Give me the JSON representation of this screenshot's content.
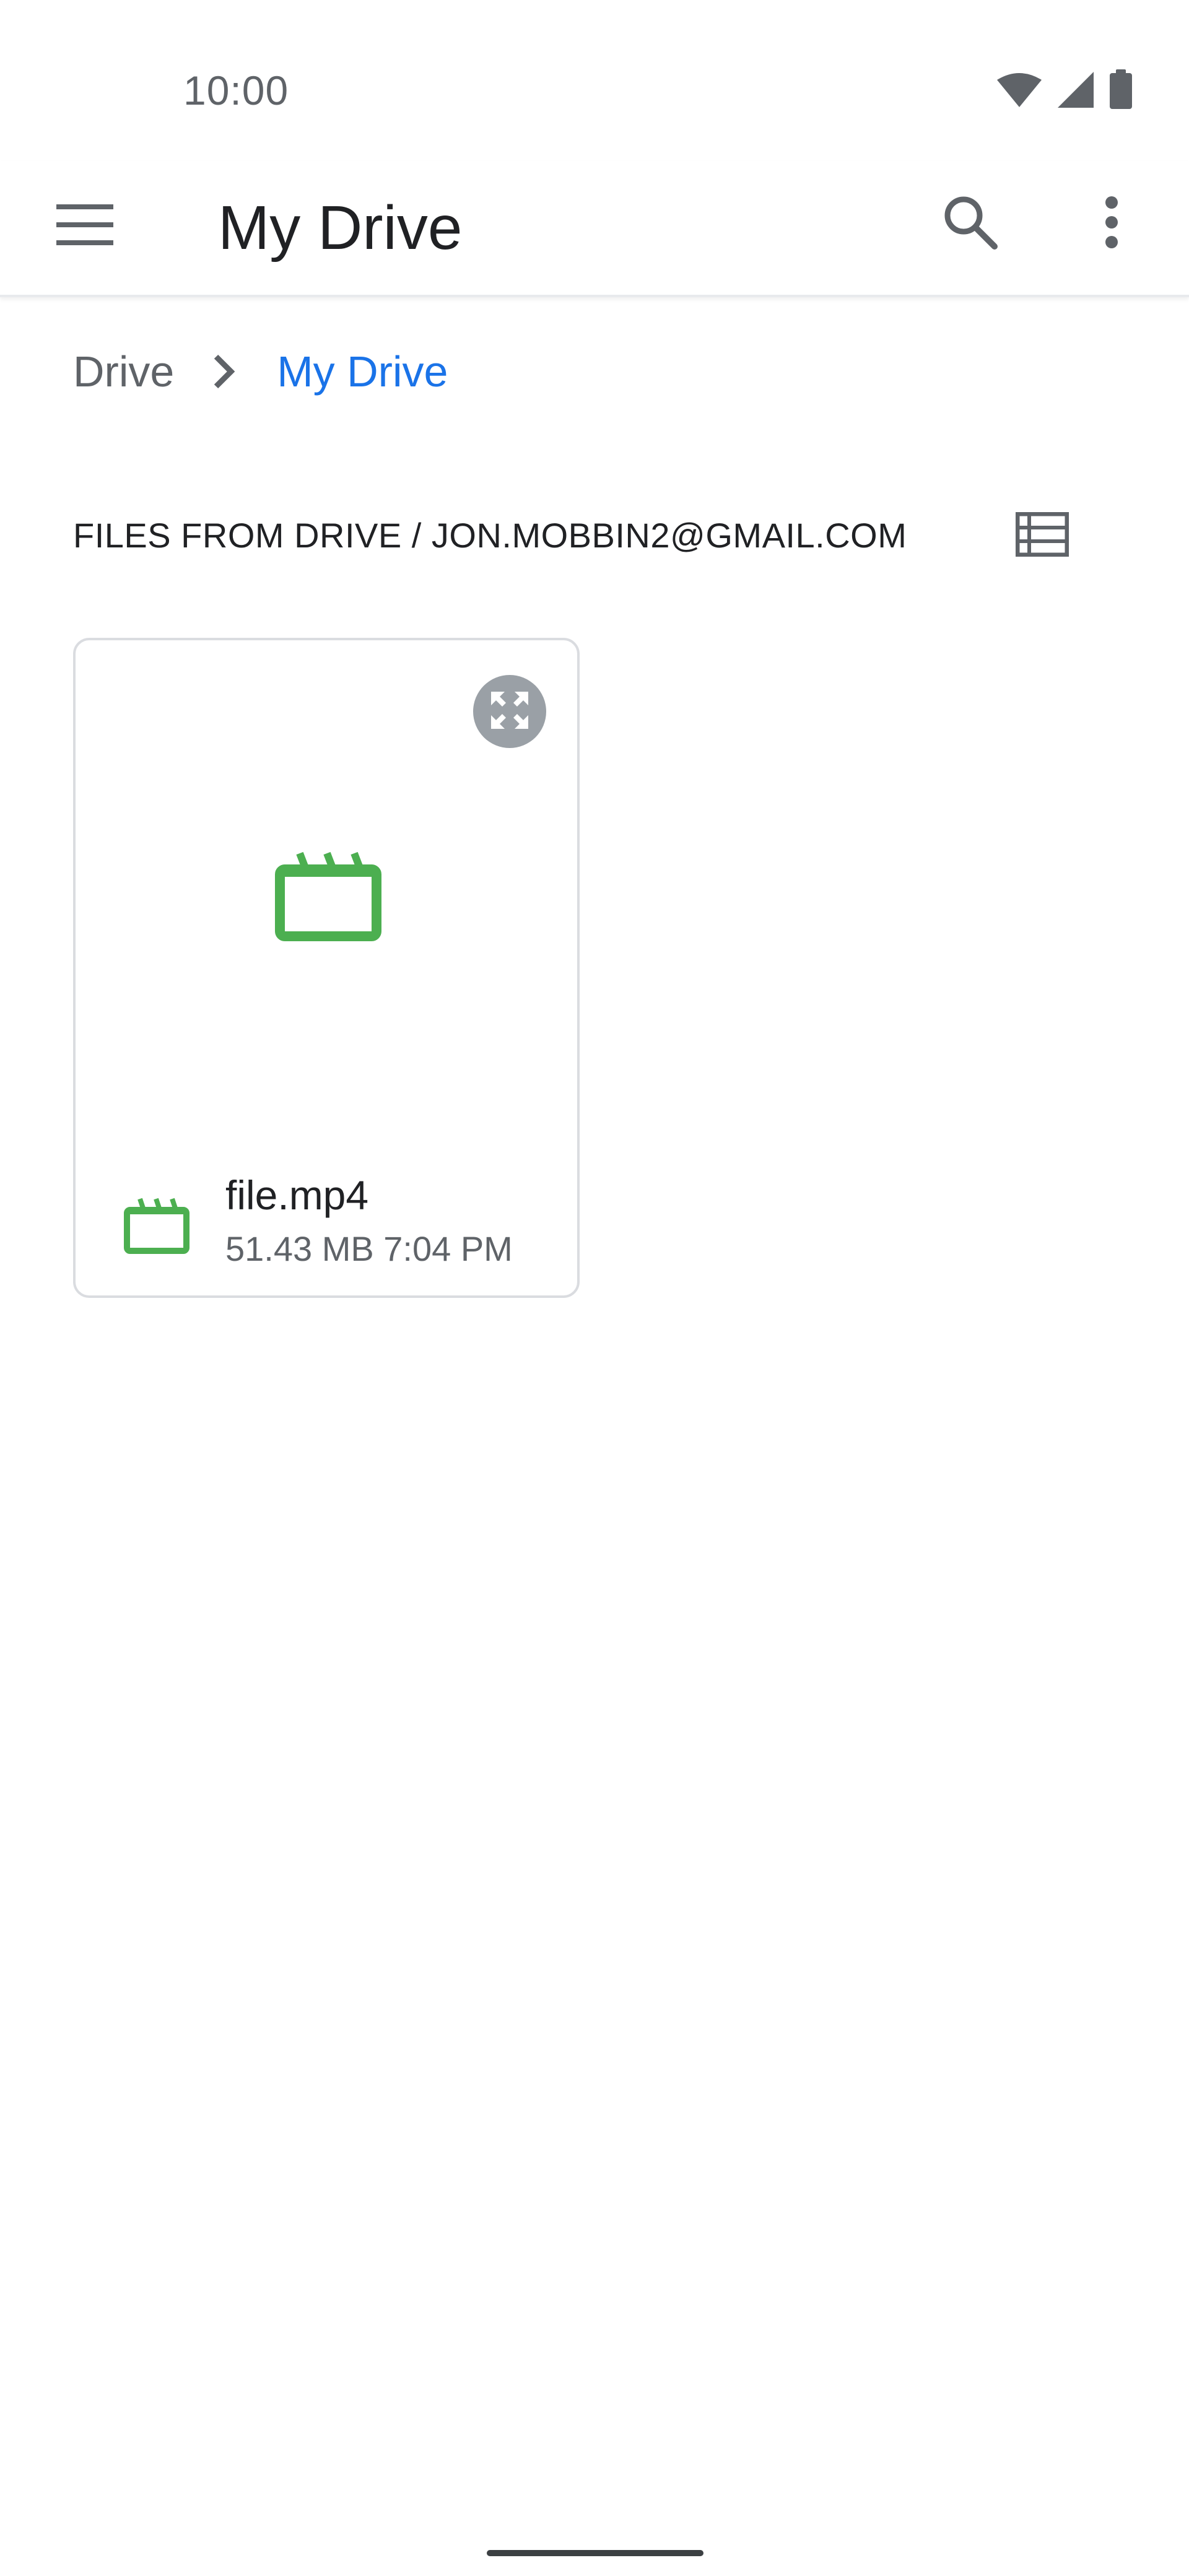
{
  "status_bar": {
    "time": "10:00",
    "icons": [
      "wifi-icon",
      "cellular-signal-icon",
      "battery-icon"
    ]
  },
  "app_bar": {
    "title": "My Drive",
    "icons": [
      "menu-icon",
      "search-icon",
      "more-vert-icon"
    ]
  },
  "breadcrumb": {
    "items": [
      "Drive",
      "My Drive"
    ],
    "separator_icon": "chevron-right-icon"
  },
  "section": {
    "header": "FILES FROM DRIVE / JON.MOBBIN2@GMAIL.COM",
    "view_toggle_icon": "list-view-icon"
  },
  "files": [
    {
      "name": "file.mp4",
      "size": "51.43 MB",
      "time": "7:04 PM",
      "type_icon": "video-file-icon",
      "preview_icon": "expand-icon"
    }
  ],
  "colors": {
    "accent": "#1a73e8",
    "video_icon": "#4caf50",
    "text_primary": "#202124",
    "text_secondary": "#5f6368",
    "card_border": "#dadce0"
  }
}
